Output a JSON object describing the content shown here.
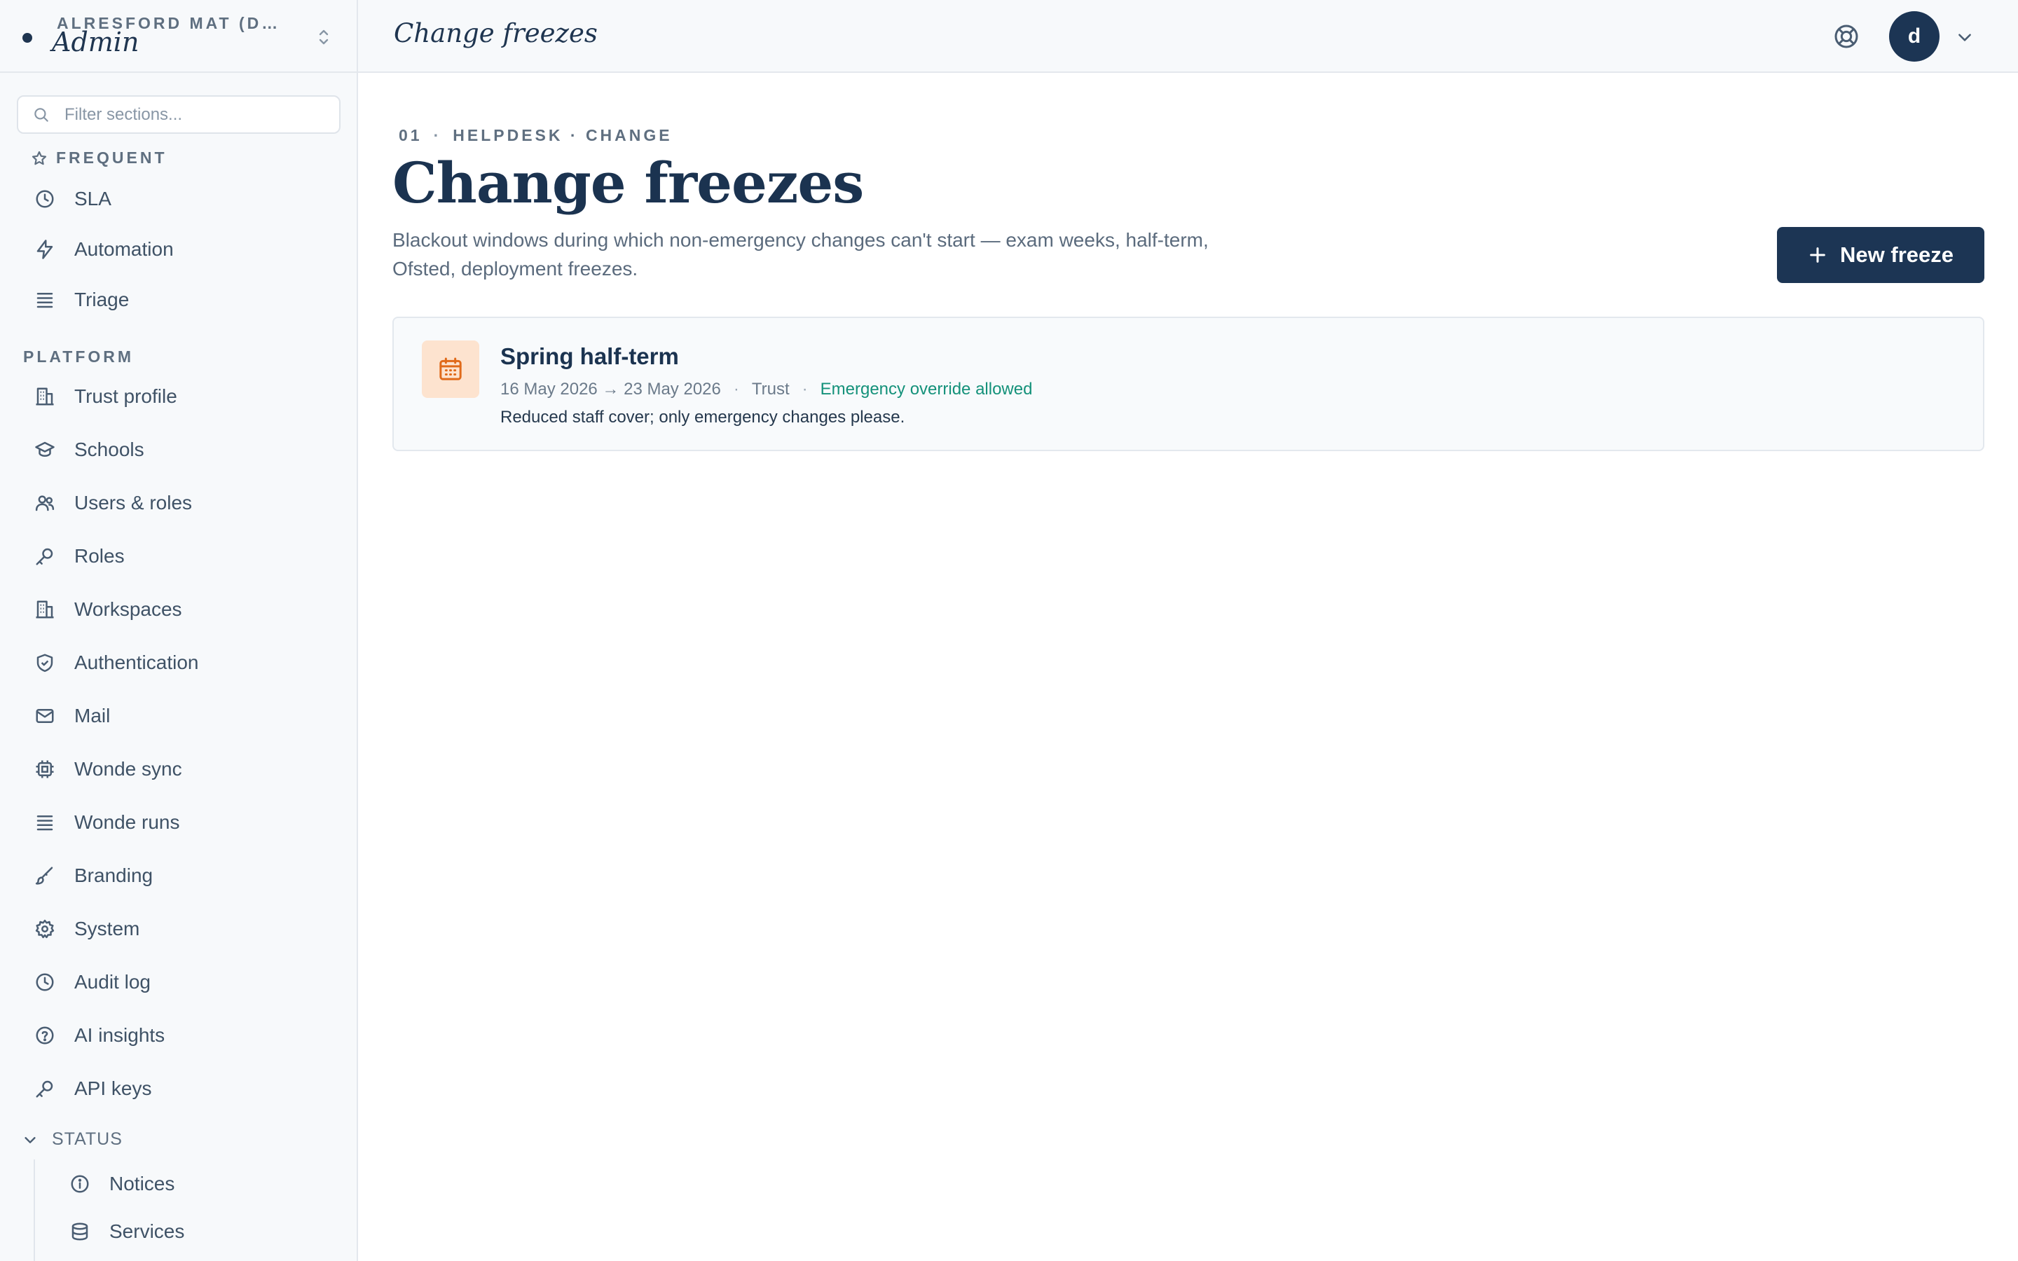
{
  "workspace": {
    "org": "ALRESFORD MAT (DEMO)",
    "name": "Admin"
  },
  "filter": {
    "placeholder": "Filter sections..."
  },
  "sidebar": {
    "frequent_label": "FREQUENT",
    "frequent": [
      {
        "label": "SLA",
        "icon": "clock-icon"
      },
      {
        "label": "Automation",
        "icon": "lightning-icon"
      },
      {
        "label": "Triage",
        "icon": "layers-icon"
      }
    ],
    "platform_label": "PLATFORM",
    "platform": [
      {
        "label": "Trust profile",
        "icon": "building-icon"
      },
      {
        "label": "Schools",
        "icon": "graduation-cap-icon"
      },
      {
        "label": "Users & roles",
        "icon": "users-icon"
      },
      {
        "label": "Roles",
        "icon": "key-icon"
      },
      {
        "label": "Workspaces",
        "icon": "building-icon"
      },
      {
        "label": "Authentication",
        "icon": "shield-check-icon"
      },
      {
        "label": "Mail",
        "icon": "mail-icon"
      },
      {
        "label": "Wonde sync",
        "icon": "chip-icon"
      },
      {
        "label": "Wonde runs",
        "icon": "layers-icon"
      },
      {
        "label": "Branding",
        "icon": "brush-icon"
      },
      {
        "label": "System",
        "icon": "gear-icon"
      },
      {
        "label": "Audit log",
        "icon": "clock-icon"
      },
      {
        "label": "AI insights",
        "icon": "help-circle-icon"
      },
      {
        "label": "API keys",
        "icon": "key-icon"
      }
    ],
    "status_label": "STATUS",
    "status": [
      {
        "label": "Notices",
        "icon": "info-icon"
      },
      {
        "label": "Services",
        "icon": "database-icon"
      }
    ]
  },
  "topbar": {
    "title": "Change freezes",
    "help_icon": "lifebuoy-icon",
    "avatar_initial": "d",
    "caret_icon": "chevron-down-icon"
  },
  "header": {
    "section_number": "01",
    "breadcrumb": "HELPDESK · CHANGE",
    "title": "Change freezes",
    "description": "Blackout windows during which non-emergency changes can't start — exam weeks, half-term, Ofsted, deployment freezes.",
    "new_button": "New freeze"
  },
  "freezes": [
    {
      "title": "Spring half-term",
      "dates": "16 May 2026 → 23 May 2026",
      "scope": "Trust",
      "override": "Emergency override allowed",
      "note": "Reduced staff cover; only emergency changes please.",
      "icon": "calendar-icon"
    }
  ],
  "colors": {
    "accent": "#1c3554",
    "ok": "#14917a",
    "freeze_icon_bg": "#fde3cf",
    "freeze_icon": "#e06a1a"
  }
}
